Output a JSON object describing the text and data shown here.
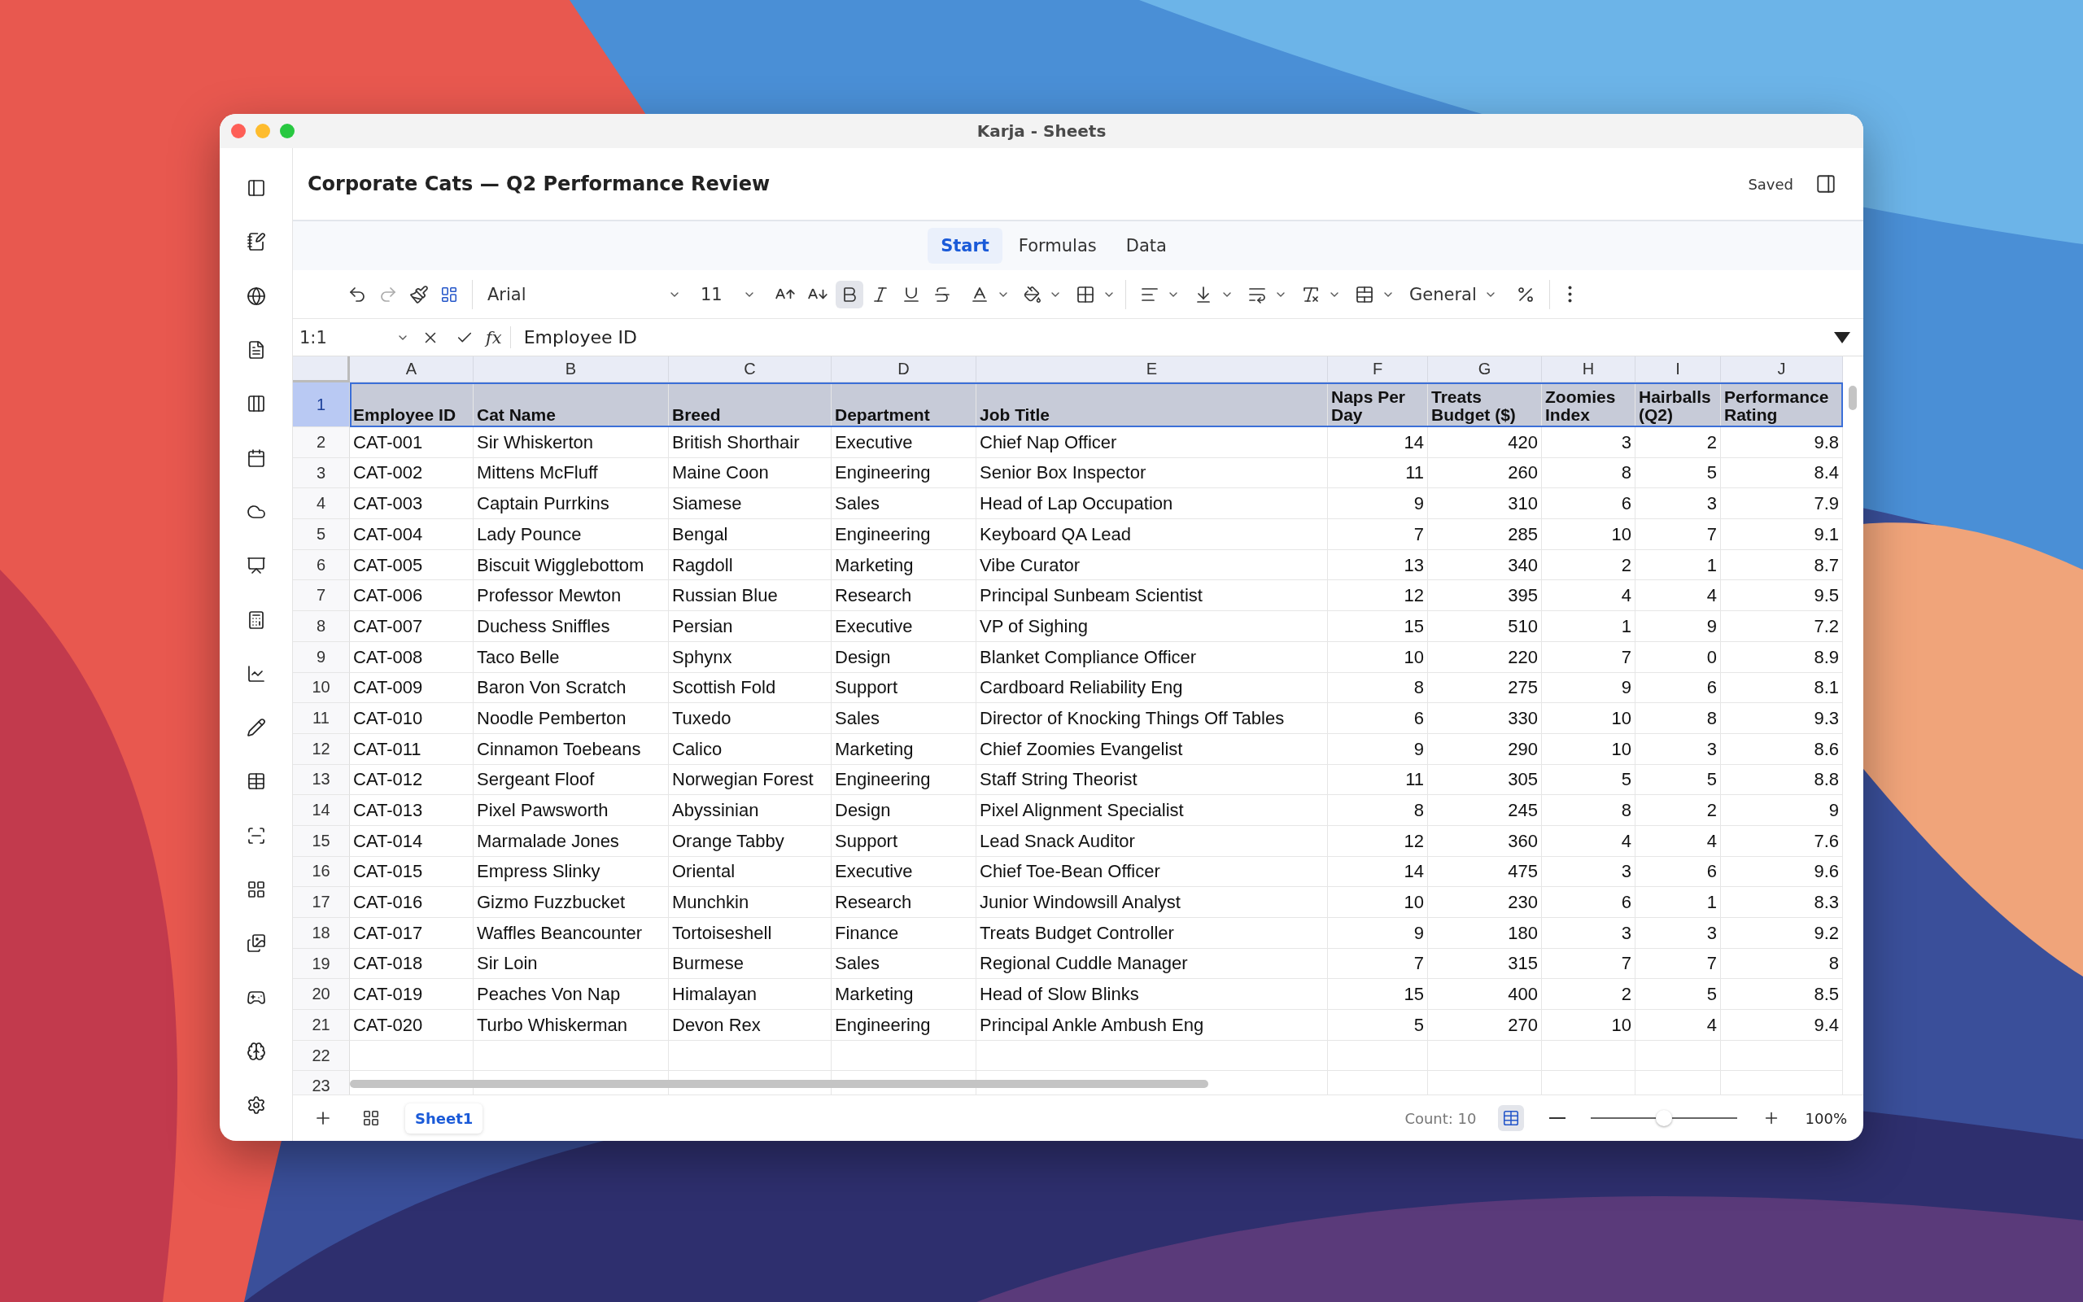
{
  "window": {
    "title": "Karja - Sheets"
  },
  "document": {
    "title": "Corporate Cats — Q2 Performance Review",
    "status": "Saved"
  },
  "tabs": [
    {
      "label": "Start",
      "selected": true
    },
    {
      "label": "Formulas",
      "selected": false
    },
    {
      "label": "Data",
      "selected": false
    }
  ],
  "toolbar": {
    "font": "Arial",
    "font_size": "11",
    "number_format": "General",
    "format_buttons": [
      {
        "kind": "bold",
        "selected": true
      },
      {
        "kind": "italic",
        "selected": false
      },
      {
        "kind": "underline",
        "selected": false
      },
      {
        "kind": "strikethrough",
        "selected": false
      }
    ]
  },
  "formula_bar": {
    "cell_reference": "1:1",
    "function_label": "fx",
    "value": "Employee ID"
  },
  "table": {
    "columns": [
      "A",
      "B",
      "C",
      "D",
      "E",
      "F",
      "G",
      "H",
      "I",
      "J"
    ],
    "rows": [
      {
        "number": "1",
        "selected": true,
        "header": true,
        "cells": [
          "Employee ID",
          "Cat Name",
          "Breed",
          "Department",
          "Job Title",
          "Naps Per Day",
          "Treats Budget ($)",
          "Zoomies Index",
          "Hairballs (Q2)",
          "Performance Rating"
        ]
      },
      {
        "number": "2",
        "selected": false,
        "cells": [
          "CAT-001",
          "Sir Whiskerton",
          "British Shorthair",
          "Executive",
          "Chief Nap Officer",
          "14",
          "420",
          "3",
          "2",
          "9.8"
        ]
      },
      {
        "number": "3",
        "selected": false,
        "cells": [
          "CAT-002",
          "Mittens McFluff",
          "Maine Coon",
          "Engineering",
          "Senior Box Inspector",
          "11",
          "260",
          "8",
          "5",
          "8.4"
        ]
      },
      {
        "number": "4",
        "selected": false,
        "cells": [
          "CAT-003",
          "Captain Purrkins",
          "Siamese",
          "Sales",
          "Head of Lap Occupation",
          "9",
          "310",
          "6",
          "3",
          "7.9"
        ]
      },
      {
        "number": "5",
        "selected": false,
        "cells": [
          "CAT-004",
          "Lady Pounce",
          "Bengal",
          "Engineering",
          "Keyboard QA Lead",
          "7",
          "285",
          "10",
          "7",
          "9.1"
        ]
      },
      {
        "number": "6",
        "selected": false,
        "cells": [
          "CAT-005",
          "Biscuit Wigglebottom",
          "Ragdoll",
          "Marketing",
          "Vibe Curator",
          "13",
          "340",
          "2",
          "1",
          "8.7"
        ]
      },
      {
        "number": "7",
        "selected": false,
        "cells": [
          "CAT-006",
          "Professor Mewton",
          "Russian Blue",
          "Research",
          "Principal Sunbeam Scientist",
          "12",
          "395",
          "4",
          "4",
          "9.5"
        ]
      },
      {
        "number": "8",
        "selected": false,
        "cells": [
          "CAT-007",
          "Duchess Sniffles",
          "Persian",
          "Executive",
          "VP of Sighing",
          "15",
          "510",
          "1",
          "9",
          "7.2"
        ]
      },
      {
        "number": "9",
        "selected": false,
        "cells": [
          "CAT-008",
          "Taco Belle",
          "Sphynx",
          "Design",
          "Blanket Compliance Officer",
          "10",
          "220",
          "7",
          "0",
          "8.9"
        ]
      },
      {
        "number": "10",
        "selected": false,
        "cells": [
          "CAT-009",
          "Baron Von Scratch",
          "Scottish Fold",
          "Support",
          "Cardboard Reliability Eng",
          "8",
          "275",
          "9",
          "6",
          "8.1"
        ]
      },
      {
        "number": "11",
        "selected": false,
        "cells": [
          "CAT-010",
          "Noodle Pemberton",
          "Tuxedo",
          "Sales",
          "Director of Knocking Things Off Tables",
          "6",
          "330",
          "10",
          "8",
          "9.3"
        ]
      },
      {
        "number": "12",
        "selected": false,
        "cells": [
          "CAT-011",
          "Cinnamon Toebeans",
          "Calico",
          "Marketing",
          "Chief Zoomies Evangelist",
          "9",
          "290",
          "10",
          "3",
          "8.6"
        ]
      },
      {
        "number": "13",
        "selected": false,
        "cells": [
          "CAT-012",
          "Sergeant Floof",
          "Norwegian Forest",
          "Engineering",
          "Staff String Theorist",
          "11",
          "305",
          "5",
          "5",
          "8.8"
        ]
      },
      {
        "number": "14",
        "selected": false,
        "cells": [
          "CAT-013",
          "Pixel Pawsworth",
          "Abyssinian",
          "Design",
          "Pixel Alignment Specialist",
          "8",
          "245",
          "8",
          "2",
          "9"
        ]
      },
      {
        "number": "15",
        "selected": false,
        "cells": [
          "CAT-014",
          "Marmalade Jones",
          "Orange Tabby",
          "Support",
          "Lead Snack Auditor",
          "12",
          "360",
          "4",
          "4",
          "7.6"
        ]
      },
      {
        "number": "16",
        "selected": false,
        "cells": [
          "CAT-015",
          "Empress Slinky",
          "Oriental",
          "Executive",
          "Chief Toe-Bean Officer",
          "14",
          "475",
          "3",
          "6",
          "9.6"
        ]
      },
      {
        "number": "17",
        "selected": false,
        "cells": [
          "CAT-016",
          "Gizmo Fuzzbucket",
          "Munchkin",
          "Research",
          "Junior Windowsill Analyst",
          "10",
          "230",
          "6",
          "1",
          "8.3"
        ]
      },
      {
        "number": "18",
        "selected": false,
        "cells": [
          "CAT-017",
          "Waffles Beancounter",
          "Tortoiseshell",
          "Finance",
          "Treats Budget Controller",
          "9",
          "180",
          "3",
          "3",
          "9.2"
        ]
      },
      {
        "number": "19",
        "selected": false,
        "cells": [
          "CAT-018",
          "Sir Loin",
          "Burmese",
          "Sales",
          "Regional Cuddle Manager",
          "7",
          "315",
          "7",
          "7",
          "8"
        ]
      },
      {
        "number": "20",
        "selected": false,
        "cells": [
          "CAT-019",
          "Peaches Von Nap",
          "Himalayan",
          "Marketing",
          "Head of Slow Blinks",
          "15",
          "400",
          "2",
          "5",
          "8.5"
        ]
      },
      {
        "number": "21",
        "selected": false,
        "cells": [
          "CAT-020",
          "Turbo Whiskerman",
          "Devon Rex",
          "Engineering",
          "Principal Ankle Ambush Eng",
          "5",
          "270",
          "10",
          "4",
          "9.4"
        ]
      },
      {
        "number": "22",
        "selected": false
      },
      {
        "number": "23",
        "selected": false
      }
    ]
  },
  "sheet_tabs": [
    {
      "label": "Sheet1",
      "selected": true
    }
  ],
  "status_bar": {
    "count": "Count: 10",
    "view_buttons": [
      {
        "kind": "grid",
        "selected": true
      }
    ],
    "zoom": {
      "level": 0.5,
      "reading": "100%"
    }
  }
}
